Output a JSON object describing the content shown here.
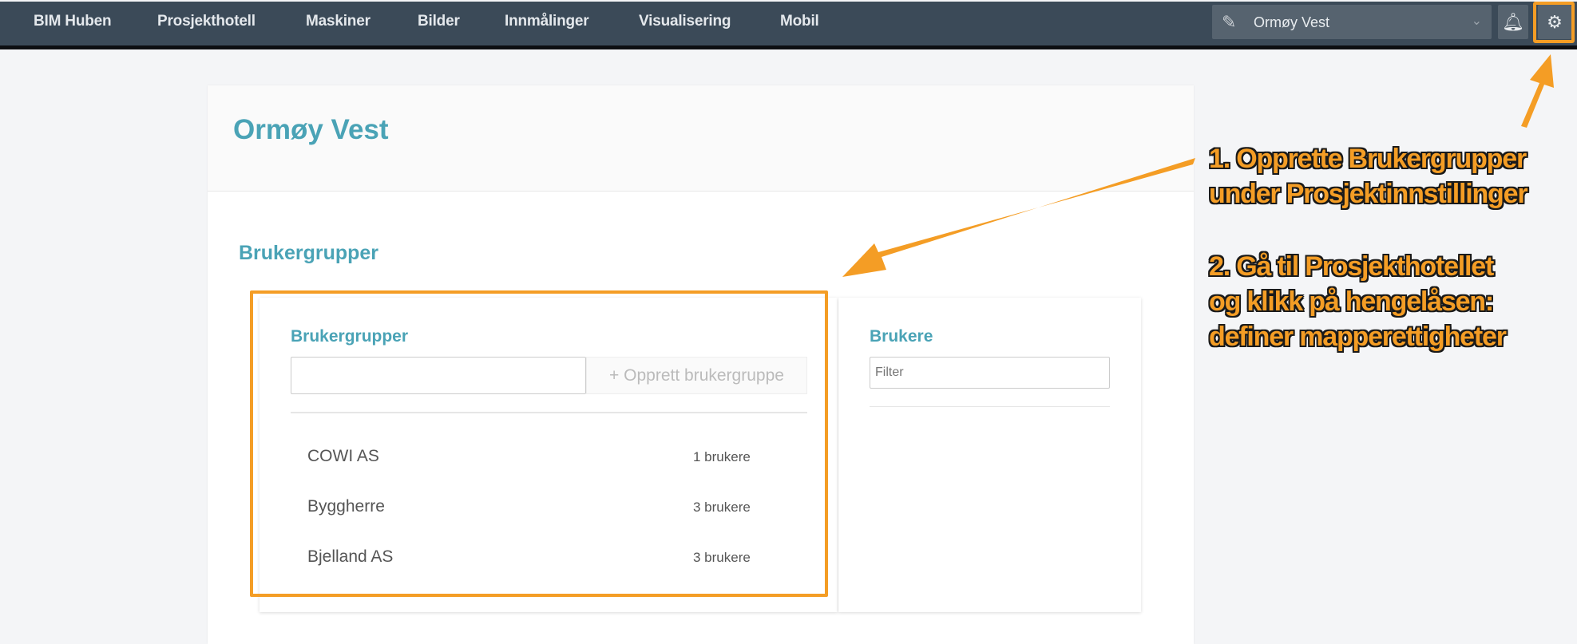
{
  "nav": {
    "items": [
      "BIM Huben",
      "Prosjekthotell",
      "Maskiner",
      "Bilder",
      "Innmålinger",
      "Visualisering",
      "Mobil"
    ],
    "project_select": "Ormøy Vest"
  },
  "page": {
    "title": "Ormøy Vest",
    "section_title": "Brukergrupper"
  },
  "groups_panel": {
    "heading": "Brukergrupper",
    "input_value": "",
    "create_button": "Opprett brukergruppe",
    "rows": [
      {
        "name": "COWI AS",
        "count": "1 brukere"
      },
      {
        "name": "Byggherre",
        "count": "3 brukere"
      },
      {
        "name": "Bjelland AS",
        "count": "3 brukere"
      }
    ]
  },
  "users_panel": {
    "heading": "Brukere",
    "filter_placeholder": "Filter"
  },
  "annotations": {
    "lines": [
      "1. Opprette Brukergrupper",
      "under Prosjektinnstillinger",
      "2. Gå til Prosjekthotellet",
      "og klikk på hengelåsen:",
      "definer mapperettigheter"
    ]
  },
  "colors": {
    "accent": "#4aa3b6",
    "highlight": "#f49d25",
    "navbar": "#3b4a58"
  }
}
